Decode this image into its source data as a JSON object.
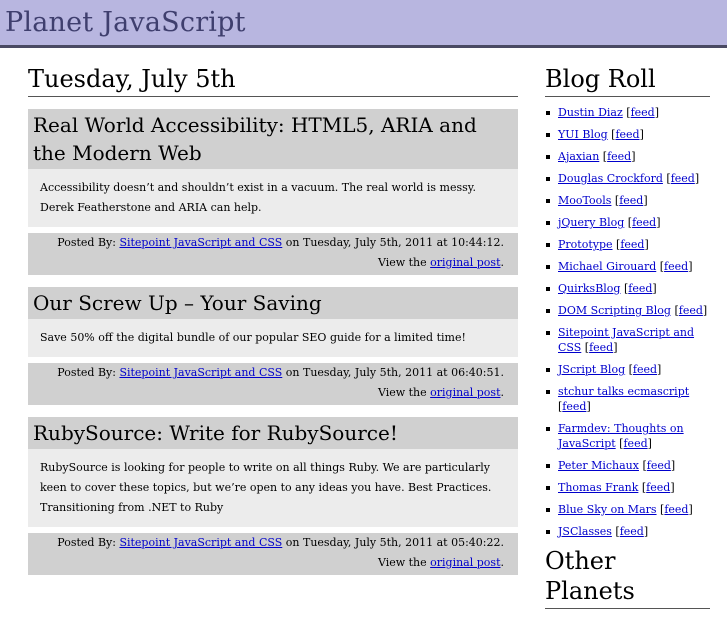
{
  "site": {
    "title": "Planet JavaScript"
  },
  "day": {
    "heading": "Tuesday, July 5th"
  },
  "posts": [
    {
      "title": "Real World Accessibility: HTML5, ARIA and the Modern Web",
      "body": "Accessibility doesn’t and shouldn’t exist in a vacuum. The real world is messy. Derek Featherstone and ARIA can help.",
      "meta_prefix": "Posted By: ",
      "author": "Sitepoint JavaScript and CSS",
      "meta_date": " on Tuesday, July 5th, 2011 at 10:44:12. View the ",
      "link": "original post",
      "suffix": "."
    },
    {
      "title": "Our Screw Up – Your Saving",
      "body": "Save 50% off the digital bundle of our popular SEO guide for a limited time!",
      "meta_prefix": "Posted By: ",
      "author": "Sitepoint JavaScript and CSS",
      "meta_date": " on Tuesday, July 5th, 2011 at 06:40:51. View the ",
      "link": "original post",
      "suffix": "."
    },
    {
      "title": "RubySource: Write for RubySource!",
      "body": "RubySource is looking for people to write on all things Ruby. We are particularly keen to cover these topics, but we’re open to any ideas you have. Best Practices. Transitioning from .NET to Ruby",
      "meta_prefix": "Posted By: ",
      "author": "Sitepoint JavaScript and CSS",
      "meta_date": " on Tuesday, July 5th, 2011 at 05:40:22. View the ",
      "link": "original post",
      "suffix": "."
    }
  ],
  "sidebar": {
    "blogroll_heading": "Blog Roll",
    "feed_label": "feed",
    "blogs": [
      "Dustin Diaz",
      "YUI Blog",
      "Ajaxian",
      "Douglas Crockford",
      "MooTools",
      "jQuery Blog",
      "Prototype",
      "Michael Girouard",
      "QuirksBlog",
      "DOM Scripting Blog",
      "Sitepoint JavaScript and CSS",
      "JScript Blog",
      "stchur talks ecmascript",
      "Farmdev: Thoughts on JavaScript",
      "Peter Michaux",
      "Thomas Frank",
      "Blue Sky on Mars",
      "JSClasses"
    ],
    "other_heading": "Other Planets"
  }
}
